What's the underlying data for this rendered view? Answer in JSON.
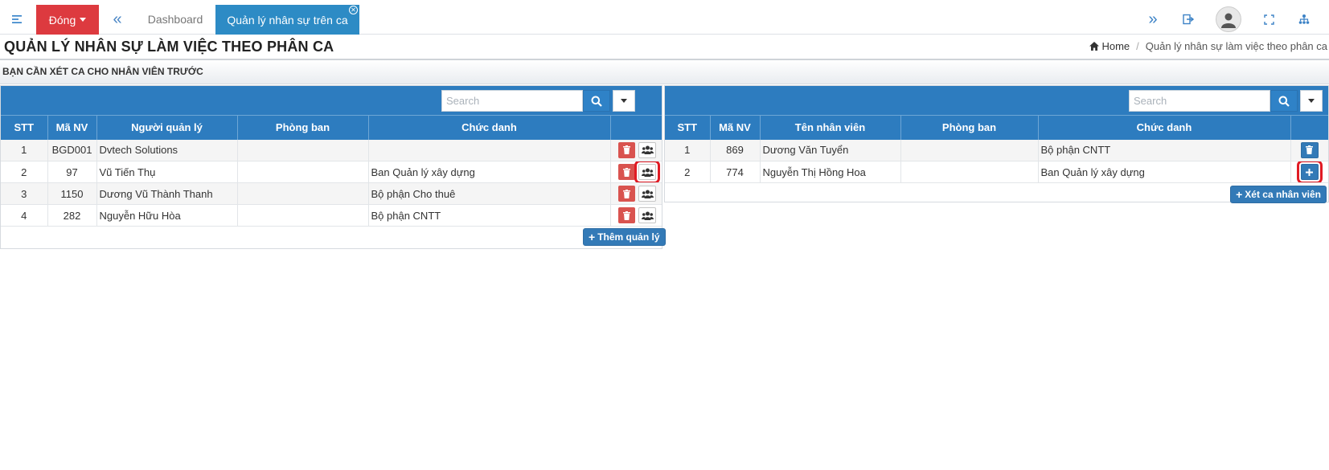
{
  "topbar": {
    "close_label": "Đóng",
    "tabs": [
      {
        "label": "Dashboard",
        "active": false
      },
      {
        "label": "Quản lý nhân sự trên ca",
        "active": true
      }
    ],
    "icons": [
      "menu-icon",
      "chevrons-left-icon",
      "chevrons-right-icon",
      "logout-icon",
      "user-avatar-icon",
      "fullscreen-icon",
      "network-icon"
    ],
    "colors": {
      "close_button": "#dd3a3f",
      "active_tab": "#2d8bc5",
      "icon": "#3c82c6"
    }
  },
  "header": {
    "title": "QUẢN LÝ NHÂN SỰ LÀM VIỆC THEO PHÂN CA",
    "breadcrumb": {
      "home": "Home",
      "separator": "/",
      "current": "Quản lý nhân sự làm việc theo phân ca"
    }
  },
  "notice": "BẠN CẦN XÉT CA CHO NHÂN VIÊN TRƯỚC",
  "left_panel": {
    "search_placeholder": "Search",
    "columns": [
      "STT",
      "Mã NV",
      "Người quản lý",
      "Phòng ban",
      "Chức danh",
      ""
    ],
    "rows": [
      {
        "stt": "1",
        "ma_nv": "BGD001",
        "name": "Dvtech Solutions",
        "phong_ban": "",
        "chuc_danh": "",
        "highlighted": false
      },
      {
        "stt": "2",
        "ma_nv": "97",
        "name": "Vũ Tiến Thụ",
        "phong_ban": "",
        "chuc_danh": "Ban Quản lý xây dựng",
        "highlighted": true
      },
      {
        "stt": "3",
        "ma_nv": "1150",
        "name": "Dương Vũ Thành Thanh",
        "phong_ban": "",
        "chuc_danh": "Bộ phận Cho thuê",
        "highlighted": false
      },
      {
        "stt": "4",
        "ma_nv": "282",
        "name": "Nguyễn Hữu Hòa",
        "phong_ban": "",
        "chuc_danh": "Bộ phận CNTT",
        "highlighted": false
      }
    ],
    "add_button": "Thêm quản lý"
  },
  "right_panel": {
    "search_placeholder": "Search",
    "columns": [
      "STT",
      "Mã NV",
      "Tên nhân viên",
      "Phòng ban",
      "Chức danh",
      ""
    ],
    "rows": [
      {
        "stt": "1",
        "ma_nv": "869",
        "name": "Dương Văn Tuyển",
        "phong_ban": "",
        "chuc_danh": "Bộ phận CNTT",
        "action": "delete",
        "highlighted": false
      },
      {
        "stt": "2",
        "ma_nv": "774",
        "name": "Nguyễn Thị Hồng Hoa",
        "phong_ban": "",
        "chuc_danh": "Ban Quản lý xây dựng",
        "action": "add",
        "highlighted": true
      }
    ],
    "assign_button": "Xét ca nhân viên"
  },
  "colors": {
    "table_header": "#2d7cbf",
    "delete_button": "#d9534f",
    "primary_button": "#337ab7",
    "highlight": "#e01b24"
  }
}
